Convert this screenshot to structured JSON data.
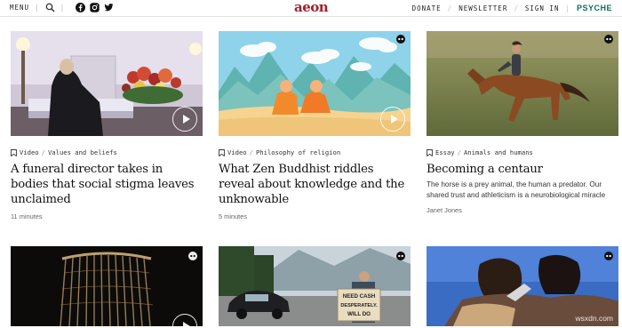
{
  "nav": {
    "menu_label": "MENU",
    "donate_label": "DONATE",
    "newsletter_label": "NEWSLETTER",
    "signin_label": "SIGN IN",
    "psyche_label": "PSYCHE",
    "logo_text": "aeon",
    "icons": [
      "search-icon",
      "facebook-icon",
      "instagram-icon",
      "twitter-icon"
    ],
    "brand_color": "#a0212e",
    "psyche_color": "#0f6e5e"
  },
  "cards": [
    {
      "type": "Video",
      "category": "Values and beliefs",
      "title": "A funeral director takes in bodies that social stigma leaves unclaimed",
      "length": "11 minutes"
    },
    {
      "type": "Video",
      "category": "Philosophy of religion",
      "title": "What Zen Buddhist riddles reveal about knowledge and the unknowable",
      "length": "5 minutes"
    },
    {
      "type": "Essay",
      "category": "Animals and humans",
      "title": "Becoming a centaur",
      "excerpt": "The horse is a prey animal, the human a predator. Our shared trust and athleticism is a neurobiological miracle",
      "author": "Janet Jones"
    }
  ],
  "bottom_row": {
    "sign_text": [
      "NEED CASH",
      "DESPERATELY.",
      "WILL DO"
    ]
  },
  "watermark": "wsxdn.com"
}
